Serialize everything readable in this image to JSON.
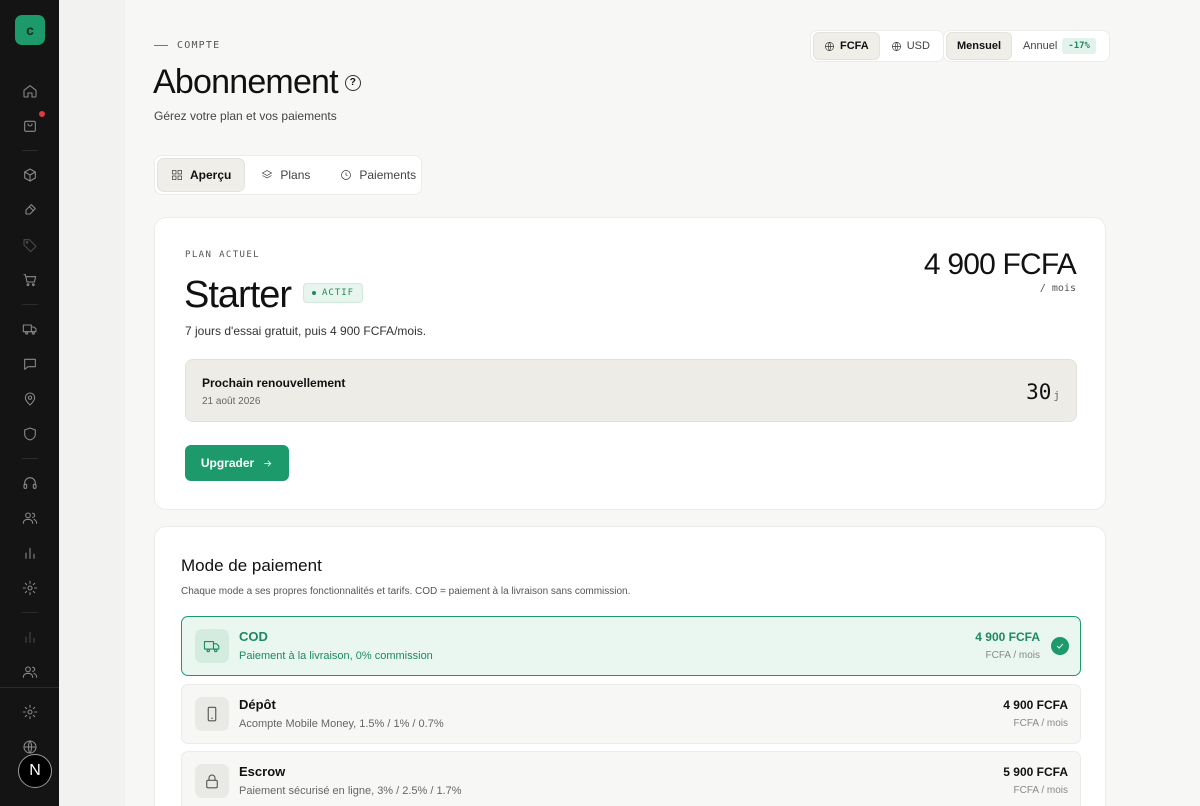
{
  "sidebar": {
    "logo_letter": "c",
    "avatar_letter": "N",
    "icons": [
      "home-icon",
      "shopping-bag-icon",
      "box-icon",
      "brush-icon",
      "tag-icon",
      "cart-icon",
      "truck-icon",
      "chat-icon",
      "map-pin-icon",
      "shield-icon",
      "headphones-icon",
      "users-icon",
      "bar-chart-icon",
      "settings-icon",
      "bar-chart-icon",
      "users-icon",
      "settings-icon",
      "globe-icon"
    ]
  },
  "header": {
    "eyebrow": "COMPTE",
    "title": "Abonnement",
    "help_glyph": "?",
    "subtitle": "Gérez votre plan et vos paiements"
  },
  "currency": {
    "options": [
      "FCFA",
      "USD"
    ],
    "selected": "FCFA"
  },
  "billing": {
    "monthly": "Mensuel",
    "yearly": "Annuel",
    "discount": "-17%",
    "selected": "Mensuel"
  },
  "tabs": [
    {
      "label": "Aperçu",
      "icon": "grid-icon",
      "active": true
    },
    {
      "label": "Plans",
      "icon": "layers-icon",
      "active": false
    },
    {
      "label": "Paiements",
      "icon": "clock-icon",
      "active": false
    }
  ],
  "plan": {
    "label": "PLAN ACTUEL",
    "name": "Starter",
    "status": "ACTIF",
    "description": "7 jours d'essai gratuit, puis 4 900 FCFA/mois.",
    "price": "4 900 FCFA",
    "price_unit": "/ mois",
    "renewal": {
      "title": "Prochain renouvellement",
      "date": "21 août 2026",
      "days": "30",
      "days_unit": "j"
    },
    "upgrade_label": "Upgrader"
  },
  "payment": {
    "title": "Mode de paiement",
    "subtitle": "Chaque mode a ses propres fonctionnalités et tarifs. COD = paiement à la livraison sans commission.",
    "options": [
      {
        "name": "COD",
        "description": "Paiement à la livraison, 0% commission",
        "price": "4 900 FCFA",
        "unit": "FCFA / mois",
        "icon": "truck-icon",
        "selected": true
      },
      {
        "name": "Dépôt",
        "description": "Acompte Mobile Money, 1.5% / 1% / 0.7%",
        "price": "4 900 FCFA",
        "unit": "FCFA / mois",
        "icon": "smartphone-icon",
        "selected": false
      },
      {
        "name": "Escrow",
        "description": "Paiement sécurisé en ligne, 3% / 2.5% / 1.7%",
        "price": "5 900 FCFA",
        "unit": "FCFA / mois",
        "icon": "lock-icon",
        "selected": false
      }
    ]
  },
  "colors": {
    "accent": "#1c9a6c",
    "sidebar": "#141414",
    "background": "#f7f7f6",
    "alert_dot": "#e0393e"
  }
}
